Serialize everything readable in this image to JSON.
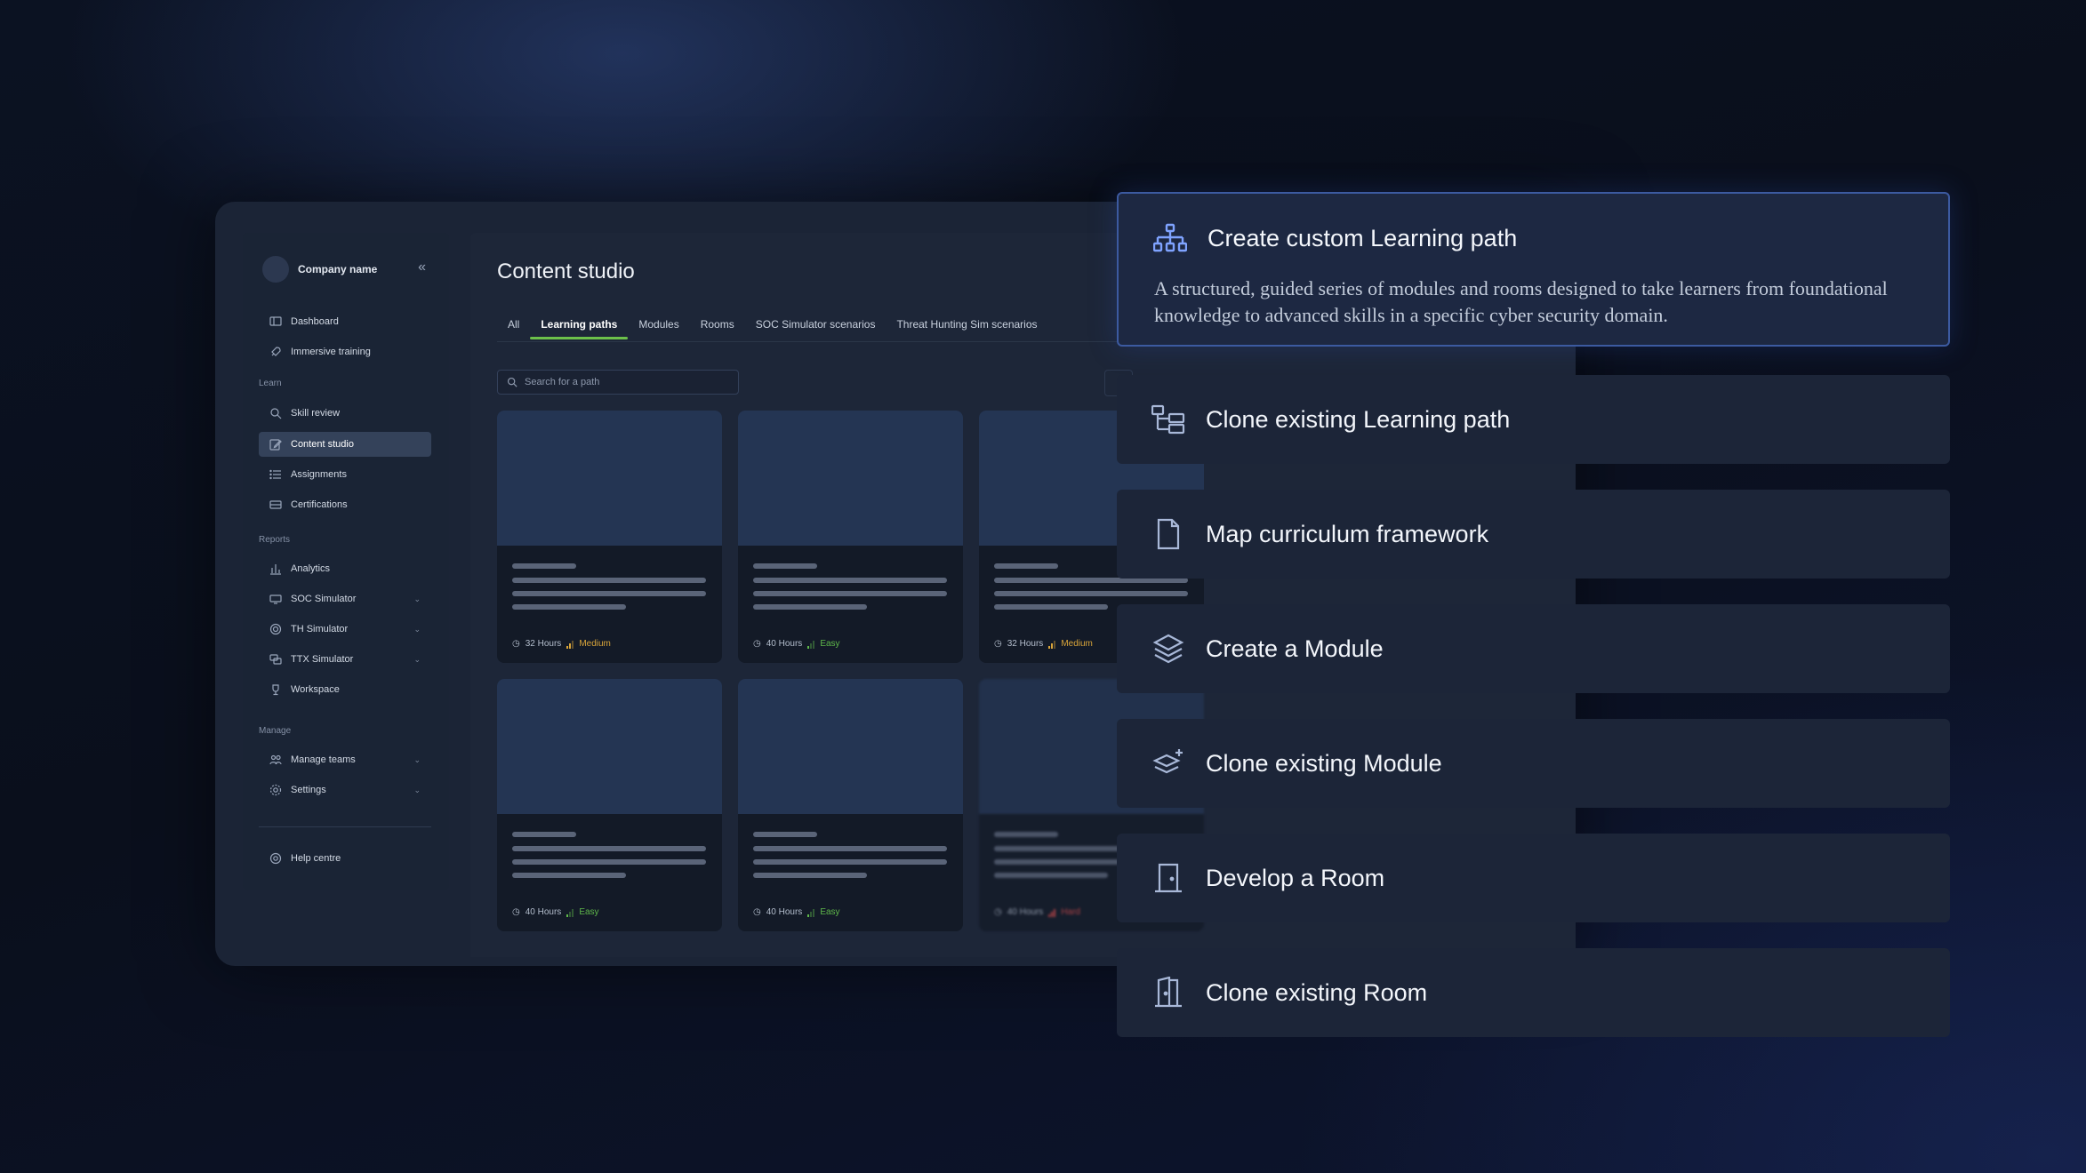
{
  "sidebar": {
    "company": "Company name",
    "items_top": [
      {
        "label": "Dashboard",
        "icon": "dashboard-icon"
      },
      {
        "label": "Immersive training",
        "icon": "rocket-icon"
      }
    ],
    "section_learn": "Learn",
    "items_learn": [
      {
        "label": "Skill review",
        "icon": "search-icon"
      },
      {
        "label": "Content studio",
        "icon": "edit-icon",
        "active": true
      },
      {
        "label": "Assignments",
        "icon": "list-icon"
      },
      {
        "label": "Certifications",
        "icon": "certificate-icon"
      }
    ],
    "section_reports": "Reports",
    "items_reports": [
      {
        "label": "Analytics",
        "icon": "chart-icon"
      },
      {
        "label": "SOC Simulator",
        "icon": "shield-icon"
      },
      {
        "label": "TH Simulator",
        "icon": "target-icon"
      },
      {
        "label": "TTX Simulator",
        "icon": "chat-icon"
      },
      {
        "label": "Workspace",
        "icon": "trophy-icon"
      }
    ],
    "section_manage": "Manage",
    "items_manage": [
      {
        "label": "Manage teams",
        "icon": "team-icon"
      },
      {
        "label": "Settings",
        "icon": "gear-icon"
      }
    ],
    "help": {
      "label": "Help centre",
      "icon": "help-icon"
    }
  },
  "main": {
    "title": "Content studio",
    "tabs": [
      "All",
      "Learning paths",
      "Modules",
      "Rooms",
      "SOC Simulator scenarios",
      "Threat Hunting Sim scenarios"
    ],
    "active_tab": "Learning paths",
    "search_placeholder": "Search for a path",
    "cards": [
      {
        "hours": "32 Hours",
        "level": "Medium"
      },
      {
        "hours": "40 Hours",
        "level": "Easy"
      },
      {
        "hours": "32 Hours",
        "level": "Medium"
      },
      {
        "hours": "40 Hours",
        "level": "Easy"
      },
      {
        "hours": "40 Hours",
        "level": "Easy"
      },
      {
        "hours": "40 Hours",
        "level": "Hard"
      }
    ]
  },
  "options": [
    {
      "title": "Create custom Learning path",
      "icon": "hierarchy-icon",
      "description": "A structured, guided series of modules and rooms designed to take learners from foundational knowledge to advanced skills in a specific cyber security domain."
    },
    {
      "title": "Clone existing Learning path",
      "icon": "clone-tree-icon"
    },
    {
      "title": "Map curriculum framework",
      "icon": "document-icon"
    },
    {
      "title": "Create a Module",
      "icon": "layers-icon"
    },
    {
      "title": "Clone existing Module",
      "icon": "layers-plus-icon"
    },
    {
      "title": "Develop a Room",
      "icon": "door-icon"
    },
    {
      "title": "Clone existing Room",
      "icon": "door-open-icon"
    }
  ]
}
